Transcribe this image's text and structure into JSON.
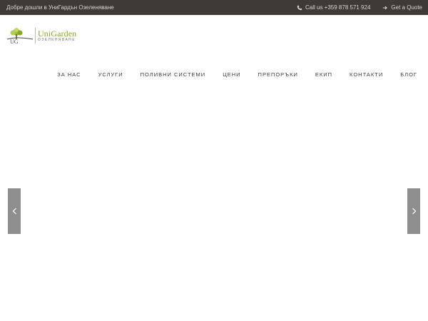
{
  "topbar": {
    "welcome": "Добре дошли в УниГардън Озеленяване",
    "phone_icon": "phone-icon",
    "phone": "Call us +359 878 571 924",
    "quote_icon": "arrow-icon",
    "quote": "Get a Quote"
  },
  "logo": {
    "brand": "UniGarden",
    "tagline": "ОЗЕЛЕНЯВАНЕ",
    "mark_icon": "tree-logo-icon"
  },
  "nav": {
    "items": [
      {
        "label": "ЗА НАС"
      },
      {
        "label": "УСЛУГИ"
      },
      {
        "label": "ПОЛИВНИ СИСТЕМИ"
      },
      {
        "label": "ЦЕНИ"
      },
      {
        "label": "ПРЕПОРЪКИ"
      },
      {
        "label": "ЕКИП"
      },
      {
        "label": "КОНТАКТИ"
      },
      {
        "label": "БЛОГ"
      }
    ]
  },
  "slider": {
    "prev_icon": "chevron-left-icon",
    "next_icon": "chevron-right-icon"
  },
  "colors": {
    "topbar_bg": "#3e3a36",
    "brand_green": "#8cab2e",
    "arrow_bg": "#8f8f8f"
  }
}
